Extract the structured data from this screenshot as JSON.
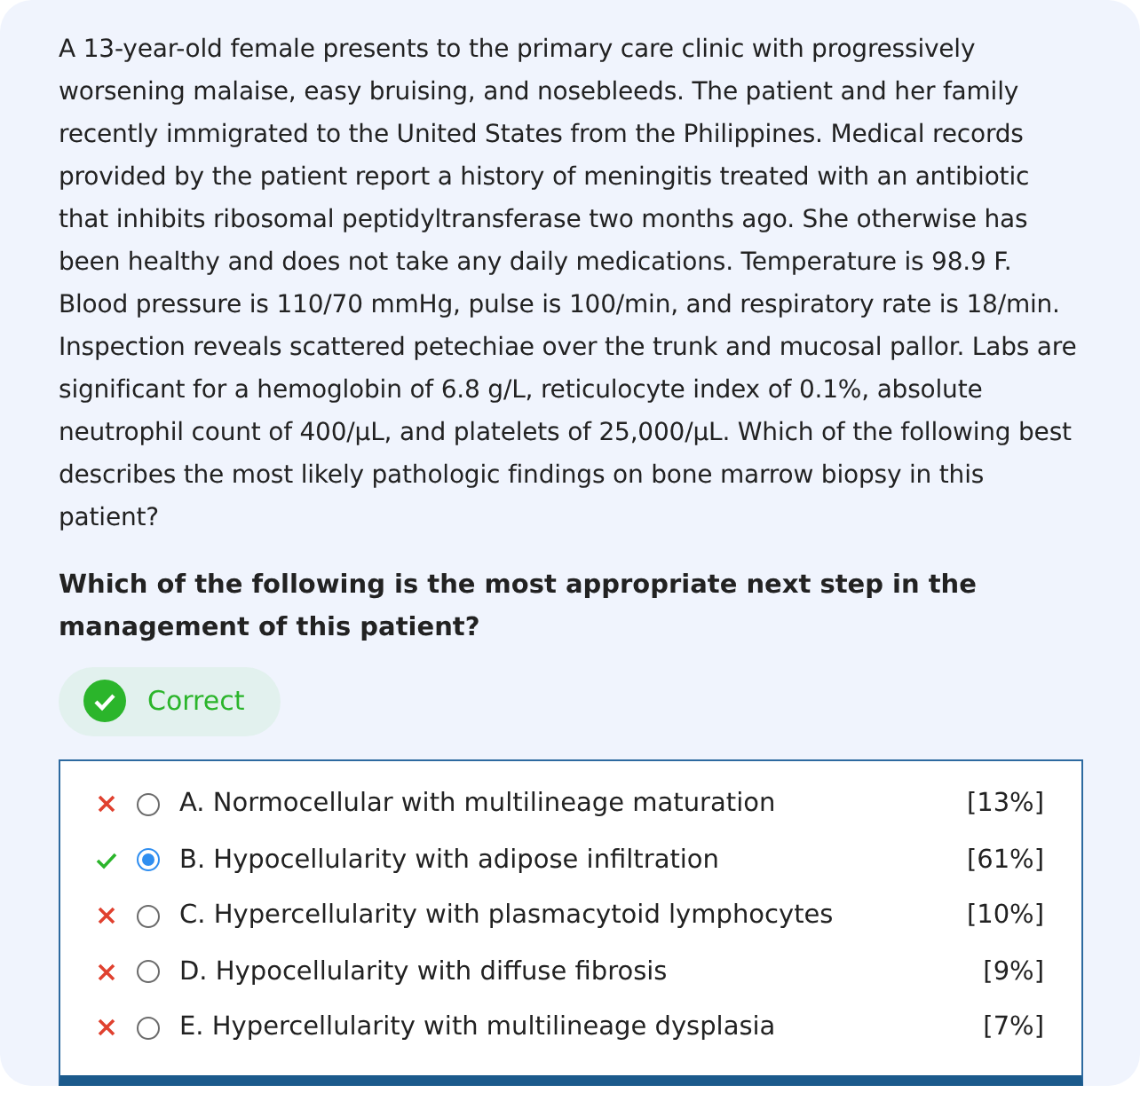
{
  "stem": "A 13-year-old female presents to the primary care clinic with progressively worsening malaise, easy bruising, and nosebleeds. The patient and her family recently immigrated to the United States from the Philippines. Medical records provided by the patient report a history of meningitis treated with an antibiotic that inhibits ribosomal peptidyltransferase two months ago. She otherwise has been healthy and does not take any daily medications. Temperature is 98.9 F. Blood pressure is 110/70 mmHg, pulse is 100/min, and respiratory rate is 18/min. Inspection reveals scattered petechiae over the trunk and mucosal pallor. Labs are significant for a hemoglobin of 6.8 g/L, reticulocyte index of 0.1%, absolute neutrophil count of 400/μL, and platelets of 25,000/μL. Which of the following best describes the most likely pathologic findings on bone marrow biopsy in this patient?",
  "question": "Which of the following is the most appropriate next step in the management of this patient?",
  "result": {
    "label": "Correct",
    "correct": true
  },
  "options": [
    {
      "text": "A. Normocellular with multilineage maturation",
      "percent": "[13%]",
      "correct": false,
      "selected": false
    },
    {
      "text": "B. Hypocellularity with adipose infiltration",
      "percent": "[61%]",
      "correct": true,
      "selected": true
    },
    {
      "text": "C. Hypercellularity with plasmacytoid lymphocytes",
      "percent": "[10%]",
      "correct": false,
      "selected": false
    },
    {
      "text": "D. Hypocellularity with diffuse fibrosis",
      "percent": "[9%]",
      "correct": false,
      "selected": false
    },
    {
      "text": "E. Hypercellularity with multilineage dysplasia",
      "percent": "[7%]",
      "correct": false,
      "selected": false
    }
  ]
}
